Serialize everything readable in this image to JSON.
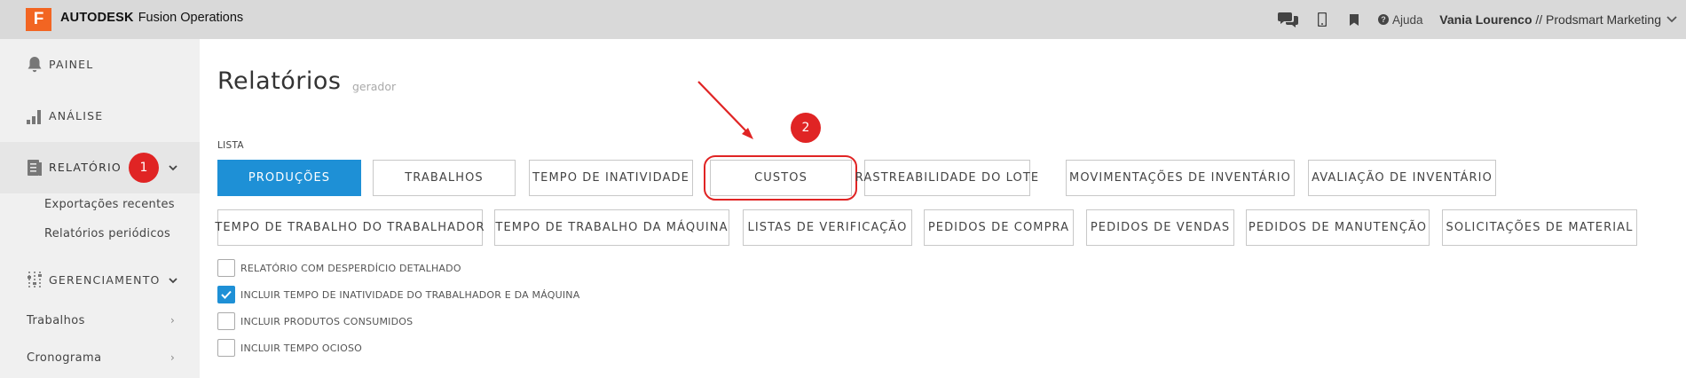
{
  "topbar": {
    "logo_letter": "F",
    "brand_bold": "AUTODESK",
    "brand_rest": "Fusion Operations",
    "help_label": "Ajuda",
    "user_name": "Vania Lourenco",
    "company": " // Prodsmart Marketing"
  },
  "sidebar": {
    "painel": "PAINEL",
    "analise": "ANÁLISE",
    "relatorio": "RELATÓRIO",
    "relatorio_badge": "1",
    "sub_exportacoes": "Exportações recentes",
    "sub_periodicos": "Relatórios periódicos",
    "gerenciamento": "GERENCIAMENTO",
    "trabalhos": "Trabalhos",
    "cronograma": "Cronograma"
  },
  "main": {
    "title": "Relatórios",
    "subtitle": "gerador",
    "list_label": "LISTA",
    "step_badge": "2",
    "row1": [
      "PRODUÇÕES",
      "TRABALHOS",
      "TEMPO DE INATIVIDADE",
      "CUSTOS",
      "RASTREABILIDADE DO LOTE",
      "MOVIMENTAÇÕES DE INVENTÁRIO",
      "AVALIAÇÃO DE INVENTÁRIO"
    ],
    "row2": [
      "TEMPO DE TRABALHO DO TRABALHADOR",
      "TEMPO DE TRABALHO DA MÁQUINA",
      "LISTAS DE VERIFICAÇÃO",
      "PEDIDOS DE COMPRA",
      "PEDIDOS DE VENDAS",
      "PEDIDOS DE MANUTENÇÃO",
      "SOLICITAÇÕES DE MATERIAL"
    ],
    "options": [
      {
        "label": "RELATÓRIO COM DESPERDÍCIO DETALHADO",
        "checked": false
      },
      {
        "label": "INCLUIR TEMPO DE INATIVIDADE DO TRABALHADOR E DA MÁQUINA",
        "checked": true
      },
      {
        "label": "INCLUIR PRODUTOS CONSUMIDOS",
        "checked": false
      },
      {
        "label": "INCLUIR TEMPO OCIOSO",
        "checked": false
      }
    ]
  },
  "colors": {
    "accent": "#1e90d6",
    "annotation": "#e02424",
    "brand_orange": "#f26522"
  }
}
